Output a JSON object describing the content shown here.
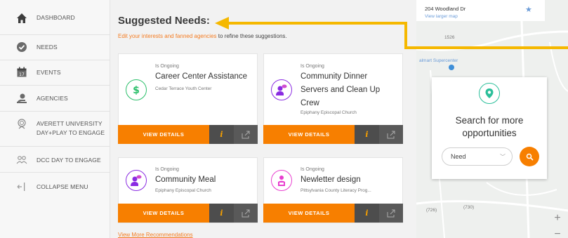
{
  "sidebar": {
    "items": [
      {
        "label": "DASHBOARD",
        "icon": "home-icon"
      },
      {
        "label": "NEEDS",
        "icon": "check-circle-icon"
      },
      {
        "label": "EVENTS",
        "icon": "calendar-icon"
      },
      {
        "label": "AGENCIES",
        "icon": "agency-icon"
      },
      {
        "label_line1": "AVERETT UNIVERSITY",
        "label_line2": "DAY+PLAY TO ENGAGE",
        "icon": "badge-icon"
      },
      {
        "label": "DCC DAY TO ENGAGE",
        "icon": "group-icon"
      },
      {
        "label": "COLLAPSE MENU",
        "icon": "collapse-icon"
      }
    ]
  },
  "main": {
    "title": "Suggested Needs:",
    "subtitle_link": "Edit your interests and fanned agencies",
    "subtitle_rest": " to refine these suggestions.",
    "more_link": "View More Recommendations"
  },
  "cards": [
    {
      "status": "Is Ongoing",
      "title": "Career Center Assistance",
      "org": "Cedar Terrace Youth Center",
      "icon": "dollar-icon",
      "color": "#2bbf6a",
      "button": "VIEW DETAILS"
    },
    {
      "status": "Is Ongoing",
      "title_lines": [
        "Community Dinner",
        "Servers and Clean Up",
        "Crew"
      ],
      "org": "Epiphany Episcopal Church",
      "icon": "person-chat-icon",
      "color": "#8a2be2",
      "button": "VIEW DETAILS"
    },
    {
      "status": "Is Ongoing",
      "title": "Community Meal",
      "org": "Epiphany Episcopal Church",
      "icon": "person-chat-icon",
      "color": "#8a2be2",
      "button": "VIEW DETAILS"
    },
    {
      "status": "Is Ongoing",
      "title": "Newletter design",
      "org": "Pittsylvania County Literacy Prog...",
      "icon": "person-book-icon",
      "color": "#e83ecf",
      "button": "VIEW DETAILS"
    }
  ],
  "map": {
    "address": "204 Woodland Dr",
    "larger_map": "View larger map",
    "supercenter": "almart Supercenter",
    "road1": "1526",
    "road2": "(726)",
    "road3": "(730)",
    "search_title_line1": "Search for more",
    "search_title_line2": "opportunities",
    "select_value": "Need"
  },
  "colors": {
    "accent": "#f77f00",
    "link": "#f47b20",
    "arrow": "#f5b800"
  }
}
